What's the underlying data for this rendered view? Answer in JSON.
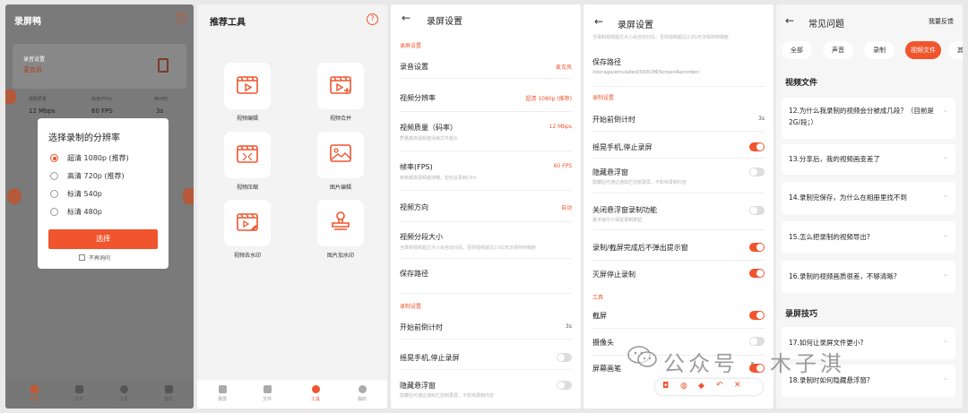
{
  "panel1": {
    "app_title": "录屏鸭",
    "card_title": "录音设置",
    "card_value": "麦克风",
    "stats": [
      {
        "label": "视频质量",
        "value": "12 Mbps"
      },
      {
        "label": "帧率(FPS)",
        "value": "60 FPS"
      },
      {
        "label": "倒计时",
        "value": "3s"
      }
    ],
    "dialog": {
      "title": "选择录制的分辨率",
      "options": [
        {
          "label": "超清 1080p (推荐)",
          "selected": true
        },
        {
          "label": "高清 720p (推荐)",
          "selected": false
        },
        {
          "label": "标清 540p",
          "selected": false
        },
        {
          "label": "标清 480p",
          "selected": false
        }
      ],
      "confirm": "选择",
      "no_ask": "不再询问"
    },
    "nav": [
      "录屏",
      "文件",
      "工具",
      "我的"
    ]
  },
  "panel2": {
    "title": "推荐工具",
    "tools": [
      {
        "label": "视频编辑",
        "icon": "video-edit-icon"
      },
      {
        "label": "视频合并",
        "icon": "video-merge-icon"
      },
      {
        "label": "视频压缩",
        "icon": "video-compress-icon"
      },
      {
        "label": "图片编辑",
        "icon": "image-edit-icon"
      },
      {
        "label": "视频去水印",
        "icon": "video-watermark-icon"
      },
      {
        "label": "图片加水印",
        "icon": "stamp-icon"
      }
    ],
    "nav": [
      "录屏",
      "文件",
      "工具",
      "我的"
    ]
  },
  "panel3": {
    "title": "录屏设置",
    "section_record": "录屏设置",
    "items": [
      {
        "label": "录音设置",
        "value": "麦克风"
      },
      {
        "label": "视频分辨率",
        "value": "超清 1080p (推荐)"
      },
      {
        "label": "视频质量（码率）",
        "sub": "质量越高视频越清晰文件越大",
        "value": "12 Mbps"
      },
      {
        "label": "帧率(FPS)",
        "sub": "帧率越高视频越流畅，但也会更耗CPU",
        "value": "60 FPS"
      },
      {
        "label": "视频方向",
        "value": "自动"
      },
      {
        "label": "视频分段大小",
        "sub": "当录制视频超过大小会自动分段，否则视频超过2.0G无法保存到相册"
      },
      {
        "label": "保存路径"
      }
    ],
    "section_control": "录制设置",
    "controls": [
      {
        "label": "开始前倒计时",
        "value": "3s"
      },
      {
        "label": "摇晃手机,停止录屏",
        "on": false
      },
      {
        "label": "隐藏悬浮窗",
        "sub": "隐藏后可通过通知栏控制录屏，不影响录制内容",
        "on": false
      }
    ]
  },
  "panel4": {
    "title": "录屏设置",
    "top_sub": "当录制视频超过大小会自动分段，否则视频超过2.0G无法保存到相册",
    "save_path_label": "保存路径",
    "save_path_value": "/storage/emulated/0/DCIM/ScreenRecorder/",
    "section_record": "录制设置",
    "items": [
      {
        "label": "开始前倒计时",
        "value": "3s"
      },
      {
        "label": "摇晃手机,停止录屏",
        "on": true
      },
      {
        "label": "隐藏悬浮窗",
        "sub": "隐藏后可通过通知栏控制录屏，不影响录制内容",
        "on": false
      },
      {
        "label": "关闭悬浮窗录制功能",
        "sub": "悬浮窗中只保留录制按钮",
        "on": false
      },
      {
        "label": "录制/截屏完成后不弹出提示窗",
        "on": true
      },
      {
        "label": "灭屏停止录制",
        "on": true
      }
    ],
    "section_tools": "工具",
    "tools": [
      {
        "label": "截屏",
        "on": true
      },
      {
        "label": "摄像头",
        "on": false
      },
      {
        "label": "屏幕画笔",
        "on": true
      }
    ]
  },
  "panel5": {
    "title": "常见问题",
    "feedback": "我要反馈",
    "chips": [
      "全部",
      "声音",
      "录制",
      "视频文件",
      "其他"
    ],
    "active_chip": "视频文件",
    "section_video": "视频文件",
    "questions_video": [
      "12.为什么我录制的视频会分被成几段？（目前是2G/段；）",
      "13.分享后，我的视频画变差了",
      "14.录制完保存，为什么在相册里找不到",
      "15.怎么把录制的视频导出?",
      "16.录制的视频画质很差，不够清晰?"
    ],
    "section_tips": "录屏技巧",
    "questions_tips": [
      "17.如何让录屏文件更小?",
      "18.录制时如何隐藏悬浮窗?"
    ]
  },
  "watermark": "公众号 · 木子淇",
  "colors": {
    "accent": "#f0552e",
    "overlay": "#7a7a7a",
    "page_bg": "#f6f6f6"
  }
}
